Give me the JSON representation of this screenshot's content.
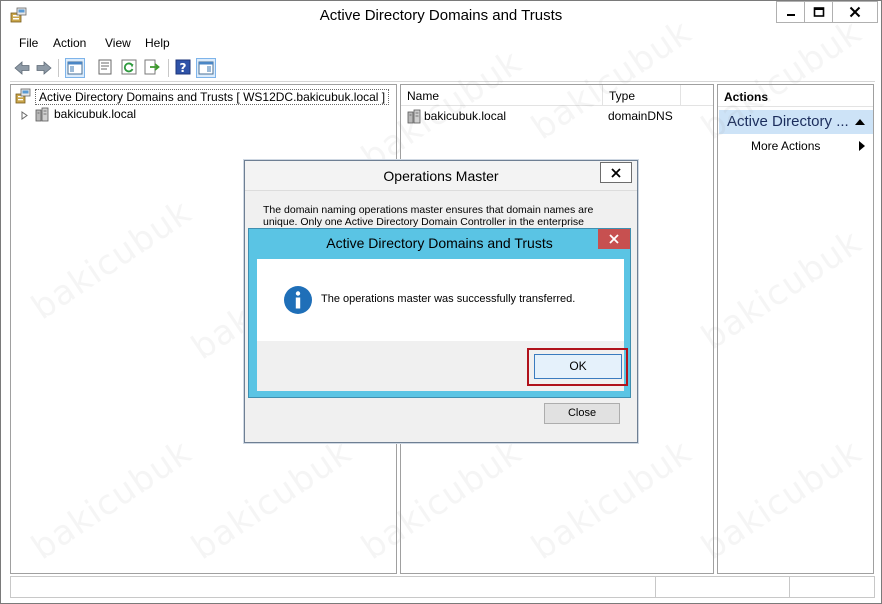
{
  "window": {
    "title": "Active Directory Domains and Trusts"
  },
  "menu": {
    "items": [
      "File",
      "Action",
      "View",
      "Help"
    ]
  },
  "toolbar": {
    "buttons": [
      "back-arrow-icon",
      "forward-arrow-icon",
      "show-hide-console-tree-icon",
      "properties-icon",
      "refresh-icon",
      "export-list-icon",
      "help-icon",
      "show-hide-action-pane-icon"
    ]
  },
  "tree": {
    "root_label": "Active Directory Domains and Trusts [ WS12DC.bakicubuk.local ]",
    "child_label": "bakicubuk.local"
  },
  "list": {
    "columns": [
      "Name",
      "Type"
    ],
    "rows": [
      {
        "name": "bakicubuk.local",
        "type": "domainDNS"
      }
    ]
  },
  "actions": {
    "header": "Actions",
    "section": "Active Directory ...",
    "items": [
      "More Actions"
    ]
  },
  "ops_dialog": {
    "title": "Operations Master",
    "description": "The domain naming operations master ensures that domain names are unique. Only one Active Directory Domain Controller in the enterprise",
    "close_label": "Close"
  },
  "message_box": {
    "title": "Active Directory Domains and Trusts",
    "message": "The operations master was successfully transferred.",
    "ok_label": "OK"
  },
  "watermark": "bakicubuk",
  "colors": {
    "selection": "#cde3f7",
    "msgbox_frame": "#5ac4e4",
    "close_red": "#c75050",
    "highlight_frame": "#b0121b",
    "info_blue": "#1f6fb8"
  }
}
